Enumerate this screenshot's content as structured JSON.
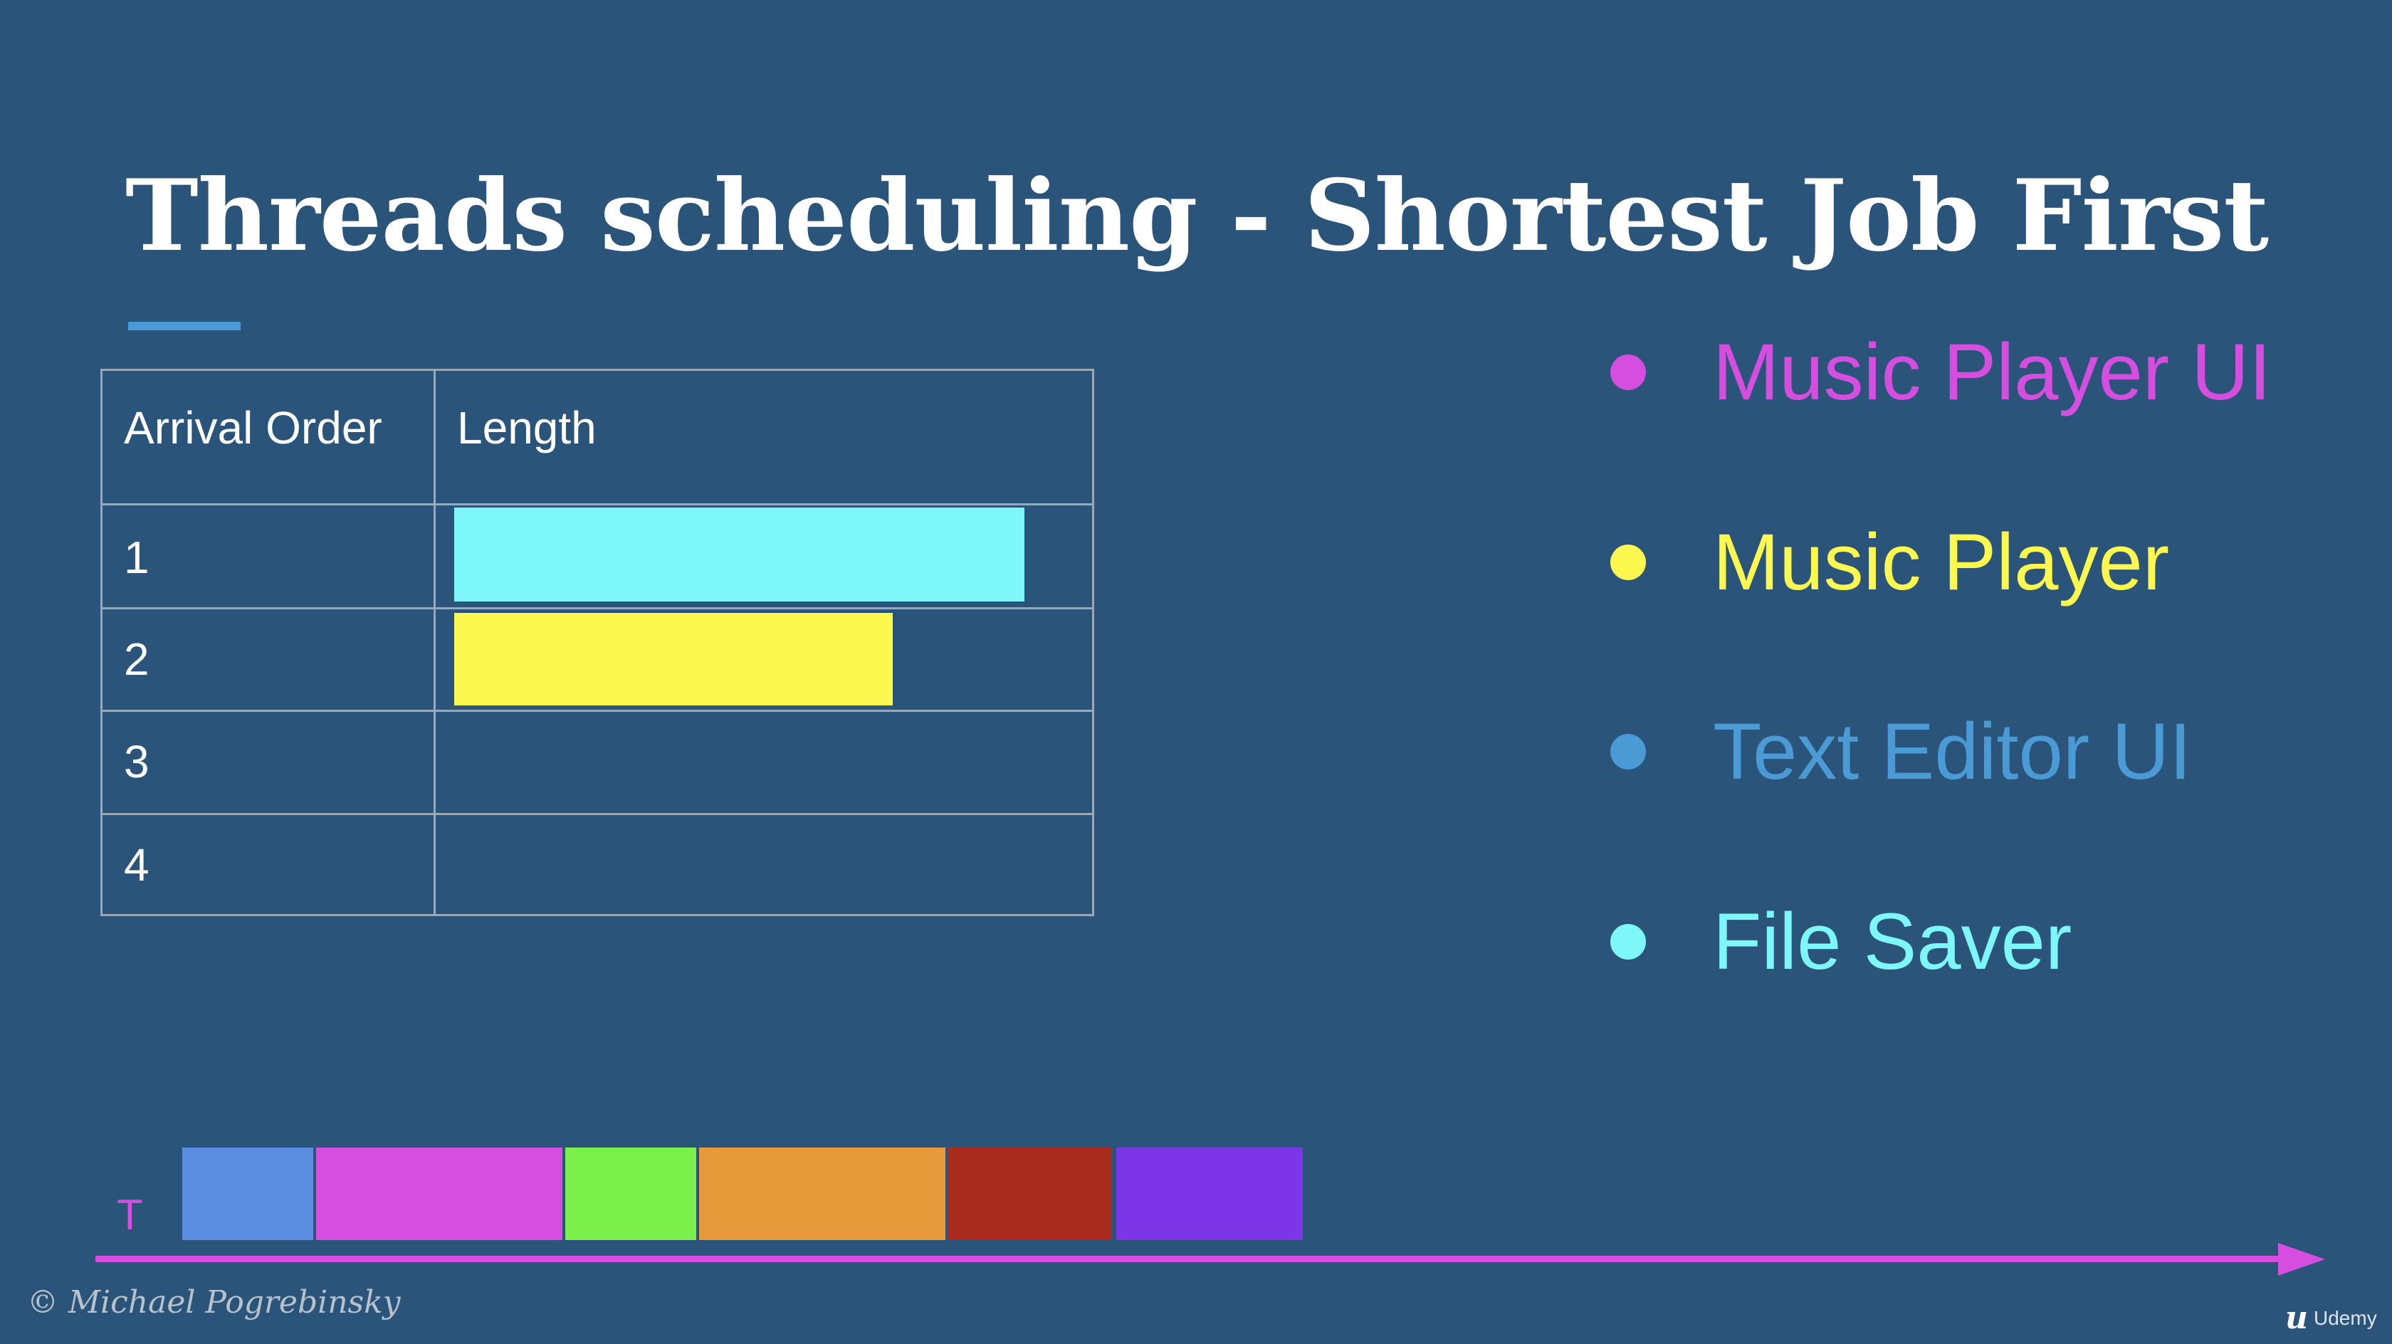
{
  "slide": {
    "title": "Threads scheduling - Shortest Job First",
    "copyright": "© Michael Pogrebinsky",
    "brand_logo": "u",
    "brand_name": "Udemy"
  },
  "table": {
    "headers": [
      "Arrival Order",
      "Length"
    ],
    "rows": [
      {
        "order": "1",
        "length_fraction": 0.84,
        "color": "#7df7f9"
      },
      {
        "order": "2",
        "length_fraction": 0.63,
        "color": "#fdf84f"
      },
      {
        "order": "3",
        "length_fraction": 0,
        "color": ""
      },
      {
        "order": "4",
        "length_fraction": 0,
        "color": ""
      }
    ]
  },
  "legend": [
    {
      "label": "Music Player UI",
      "color": "#d64ee0"
    },
    {
      "label": "Music Player",
      "color": "#fdf84f"
    },
    {
      "label": "Text Editor UI",
      "color": "#4a9ad6"
    },
    {
      "label": "File Saver",
      "color": "#7df7f9"
    }
  ],
  "timeline": {
    "axis_label": "T",
    "axis_color": "#d64ee0",
    "blocks": [
      {
        "color": "#5b8ee0"
      },
      {
        "color": "#d64ee0"
      },
      {
        "color": "#7cf04a"
      },
      {
        "color": "#e79a3a"
      },
      {
        "color": "#a82b1e"
      },
      {
        "color": "#7d35e8"
      }
    ]
  }
}
